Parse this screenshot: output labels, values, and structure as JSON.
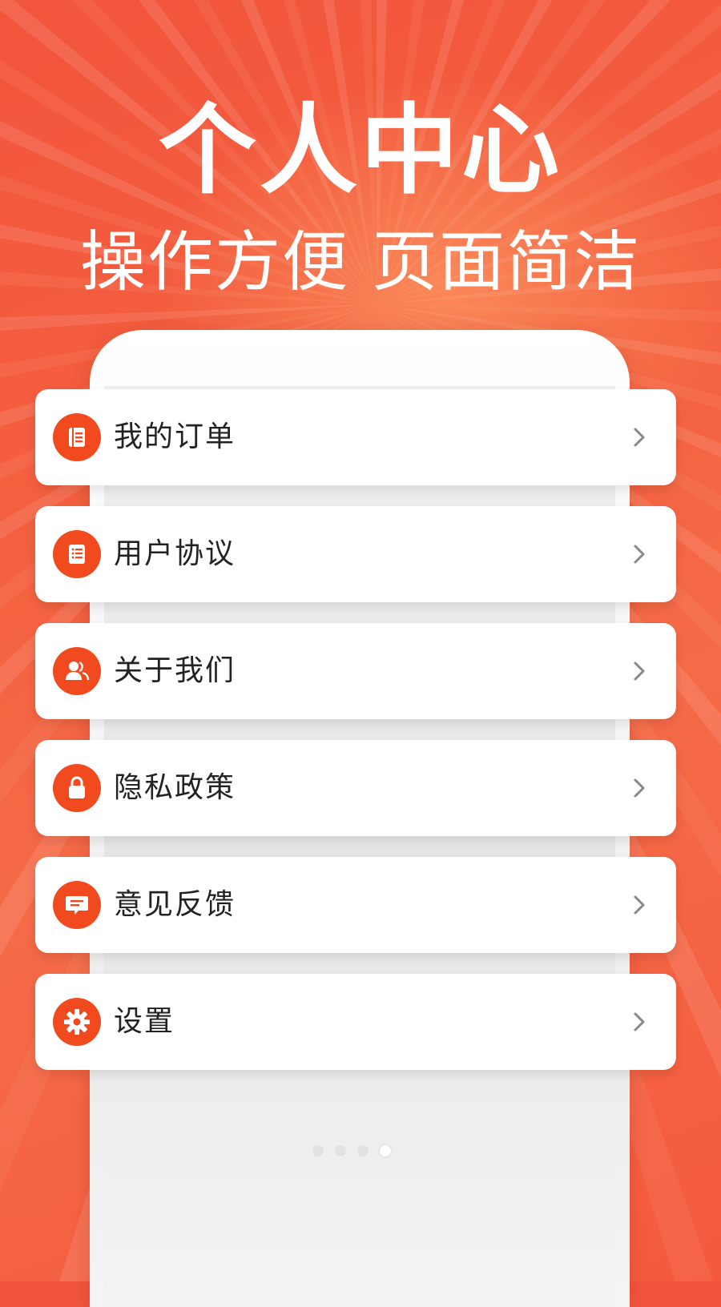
{
  "header": {
    "title": "个人中心",
    "subtitle": "操作方便 页面简洁"
  },
  "menu": {
    "items": [
      {
        "label": "我的订单",
        "icon": "order-list-icon"
      },
      {
        "label": "用户协议",
        "icon": "document-icon"
      },
      {
        "label": "关于我们",
        "icon": "users-icon"
      },
      {
        "label": "隐私政策",
        "icon": "lock-icon"
      },
      {
        "label": "意见反馈",
        "icon": "message-icon"
      },
      {
        "label": "设置",
        "icon": "gear-icon"
      }
    ]
  },
  "carousel": {
    "pages": 4,
    "active_index": 3
  },
  "colors": {
    "accent": "#f04a1e",
    "background": "#f2553c",
    "card": "#ffffff"
  }
}
